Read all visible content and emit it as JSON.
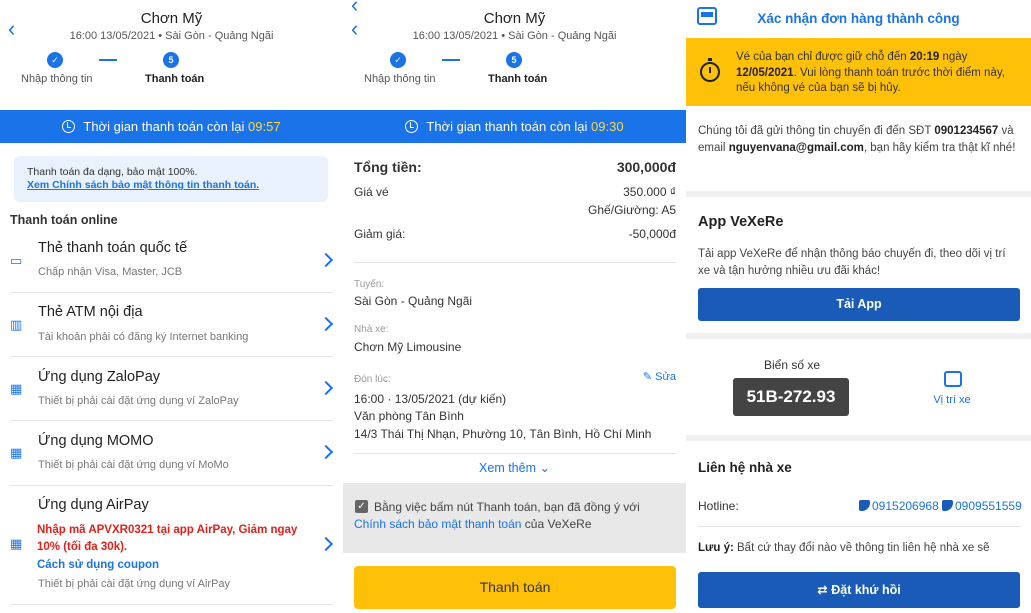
{
  "header": {
    "title": "Chơn Mỹ",
    "subtitle": "16:00 13/05/2021 • Sài Gòn - Quảng Ngãi",
    "step1_label": "Nhập thông tin",
    "step2_label": "Thanh toán",
    "step2_number": "5",
    "back_icon": "back-arrow-icon"
  },
  "timer1": {
    "text": "Thời gian thanh toán còn lại",
    "value": "09:57"
  },
  "timer2": {
    "text": "Thời gian thanh toán còn lại",
    "value": "09:30"
  },
  "panel1": {
    "notice_text": "Thanh toán đa dạng, bảo mật 100%.",
    "notice_link": "Xem Chính sách bảo mật thông tin thanh toán.",
    "section_title": "Thanh toán online",
    "methods": [
      {
        "title": "Thẻ thanh toán quốc tế",
        "desc": "Chấp nhận Visa, Master, JCB",
        "icon": "credit-card-icon"
      },
      {
        "title": "Thẻ ATM nội địa",
        "desc": "Tài khoản phải có đăng ký Internet banking",
        "icon": "atm-icon"
      },
      {
        "title": "Ứng dụng ZaloPay",
        "desc": "Thiết bị phải cài đặt ứng dụng ví ZaloPay",
        "icon": "qr-icon"
      },
      {
        "title": "Ứng dụng MOMO",
        "desc": "Thiết bị phải cài đặt ứng dụng ví MoMo",
        "icon": "qr-icon"
      },
      {
        "title": "Ứng dụng AirPay",
        "promo": "Nhập mã APVXR0321 tại app AirPay, Giảm ngay 10% (tối đa 30k).",
        "howto": "Cách sử dụng coupon",
        "desc": "Thiết bị phải cài đặt ứng dụng ví AirPay",
        "icon": "qr-icon"
      }
    ]
  },
  "panel2": {
    "total_label": "Tổng tiền:",
    "total_value": "300,000đ",
    "price_label": "Giá vé",
    "price_value": "350.000 ₫",
    "seat_value": "Ghế/Giường: A5",
    "discount_label": "Giảm giá:",
    "discount_value": "-50,000đ",
    "route_label": "Tuyến:",
    "route_value": "Sài Gòn - Quảng Ngãi",
    "operator_label": "Nhà xe:",
    "operator_value": "Chơn Mỹ Limousine",
    "pickup_label": "Đón lúc:",
    "edit_label": "Sửa",
    "pickup_time": "16:00 · 13/05/2021 (dự kiến)",
    "pickup_place": "Văn phòng Tân Bình",
    "pickup_address": "14/3 Thái Thị Nhạn, Phường 10, Tân Bình, Hồ Chí Minh",
    "more_label": "Xem thêm",
    "agree_text": "Bằng việc bấm nút Thanh toán, bạn đã đồng ý với",
    "agree_link": "Chính sách bảo mật thanh toán",
    "agree_suffix": "của VeXeRe",
    "pay_button": "Thanh toán"
  },
  "panel3": {
    "title": "Xác nhận đơn hàng thành công",
    "warn_pre": "Vé của bạn chỉ được giữ chỗ đến",
    "warn_time": "20:19",
    "warn_mid": "ngày",
    "warn_date": "12/05/2021",
    "warn_post": ". Vui lòng thanh toán trước thời điểm này, nếu không vé của bạn sẽ bị hủy.",
    "info_pre": "Chúng tôi đã gửi thông tin chuyến đi đến SĐT",
    "phone": "0901234567",
    "info_mid": "và email",
    "email": "nguyenvana@gmail.com",
    "info_post": ", bạn hãy kiểm tra thật kĩ nhé!",
    "app_title": "App VeXeRe",
    "app_desc": "Tải app VeXeRe để nhận thông báo chuyến đi, theo dõi vị trí xe và tận hưởng nhiều ưu đãi khác!",
    "download_button": "Tải App",
    "plate_label": "Biển số xe",
    "plate_value": "51B-272.93",
    "position_label": "Vị trí xe",
    "contact_title": "Liên hệ nhà xe",
    "hotline_label": "Hotline:",
    "hotline1": "0915206968",
    "hotline2": "0909551559",
    "note_label": "Lưu ý:",
    "note_text": "Bất cứ thay đổi nào về thông tin liên hệ nhà xe sẽ",
    "return_button": "Đặt khứ hồi"
  }
}
